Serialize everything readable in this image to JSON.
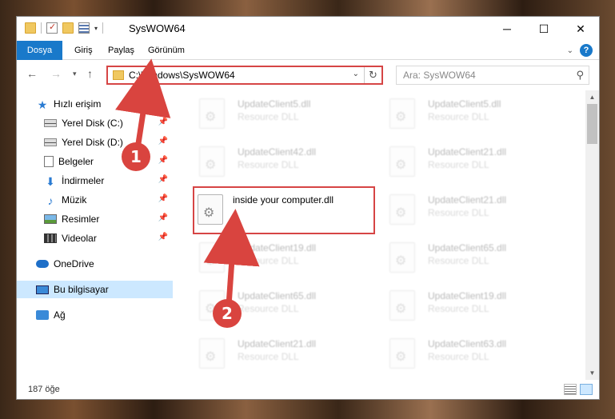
{
  "window": {
    "title": "SysWOW64",
    "controls": {
      "minimize": "─",
      "maximize": "☐",
      "close": "✕"
    }
  },
  "ribbon": {
    "tabs": [
      {
        "label": "Dosya",
        "active": true
      },
      {
        "label": "Giriş"
      },
      {
        "label": "Paylaş"
      },
      {
        "label": "Görünüm"
      }
    ],
    "help": "?"
  },
  "nav": {
    "back": "←",
    "forward": "→",
    "recent": "▾",
    "up": "↑",
    "address": "C:\\Windows\\SysWOW64",
    "refresh": "↻",
    "search_placeholder": "Ara: SysWOW64"
  },
  "sidebar": {
    "items": [
      {
        "label": "Hızlı erişim",
        "icon": "star-icon"
      },
      {
        "label": "Yerel Disk (C:)",
        "icon": "drive-icon",
        "pinned": true
      },
      {
        "label": "Yerel Disk (D:)",
        "icon": "drive-icon",
        "pinned": true
      },
      {
        "label": "Belgeler",
        "icon": "documents-icon",
        "pinned": true
      },
      {
        "label": "İndirmeler",
        "icon": "downloads-icon",
        "pinned": true
      },
      {
        "label": "Müzik",
        "icon": "music-icon",
        "pinned": true
      },
      {
        "label": "Resimler",
        "icon": "pictures-icon",
        "pinned": true
      },
      {
        "label": "Videolar",
        "icon": "videos-icon",
        "pinned": true
      },
      {
        "label": "OneDrive",
        "icon": "onedrive-icon"
      },
      {
        "label": "Bu bilgisayar",
        "icon": "computer-icon",
        "selected": true
      },
      {
        "label": "Ağ",
        "icon": "network-icon"
      }
    ]
  },
  "files": [
    {
      "name": "UpdateClient5.dll",
      "type": "Resource DLL",
      "blurred": true
    },
    {
      "name": "UpdateClient5.dll",
      "type": "Resource DLL",
      "blurred": true
    },
    {
      "name": "UpdateClient42.dll",
      "type": "Resource DLL",
      "blurred": true
    },
    {
      "name": "UpdateClient21.dll",
      "type": "Resource DLL",
      "blurred": true
    },
    {
      "name": "inside your computer.dll",
      "type": "",
      "blurred": false,
      "highlighted": true
    },
    {
      "name": "UpdateClient21.dll",
      "type": "Resource DLL",
      "blurred": true
    },
    {
      "name": "UpdateClient19.dll",
      "type": "Resource DLL",
      "blurred": true
    },
    {
      "name": "UpdateClient65.dll",
      "type": "Resource DLL",
      "blurred": true
    },
    {
      "name": "UpdateClient65.dll",
      "type": "Resource DLL",
      "blurred": true
    },
    {
      "name": "UpdateClient19.dll",
      "type": "Resource DLL",
      "blurred": true
    },
    {
      "name": "UpdateClient21.dll",
      "type": "Resource DLL",
      "blurred": true
    },
    {
      "name": "UpdateClient63.dll",
      "type": "Resource DLL",
      "blurred": true
    }
  ],
  "status": {
    "count": "187 öğe"
  },
  "annotations": [
    {
      "number": "1"
    },
    {
      "number": "2"
    }
  ],
  "colors": {
    "accent": "#1979ca",
    "annotation": "#d9443f",
    "highlight_border": "#d64545"
  }
}
